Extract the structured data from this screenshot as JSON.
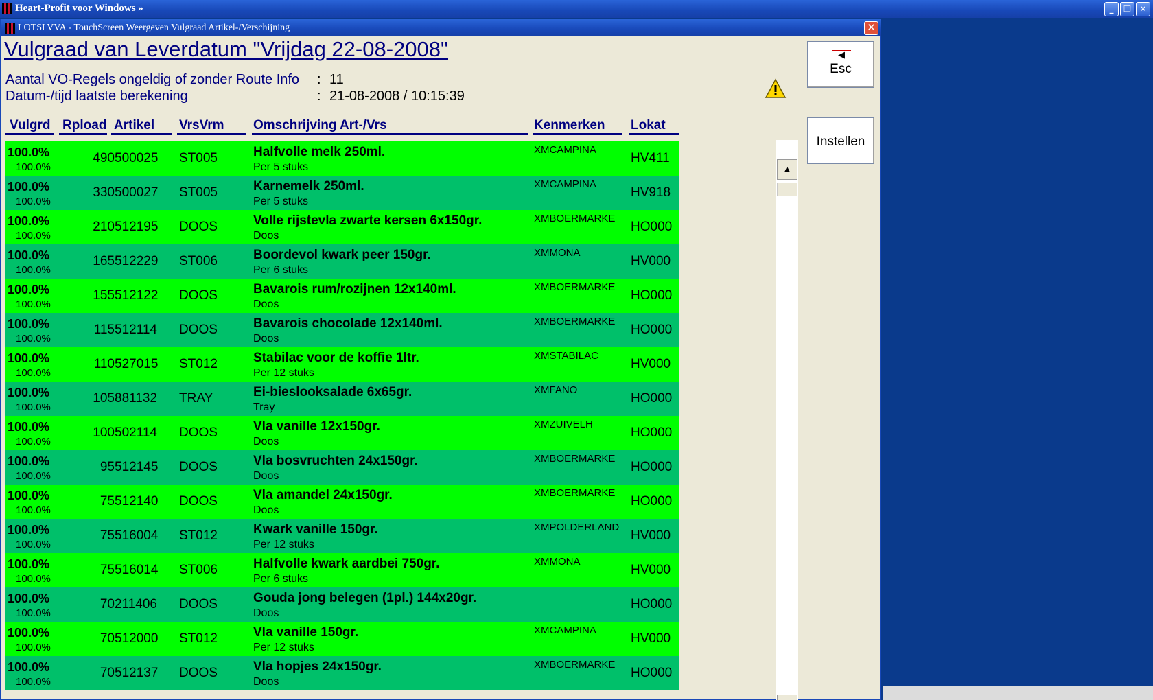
{
  "app": {
    "title": "Heart-Profit voor Windows  »"
  },
  "window": {
    "title": "LOTSLVVA - TouchScreen Weergeven Vulgraad Artikel-/Verschijning",
    "close_label": "✕"
  },
  "page_title": "Vulgraad van Leverdatum \"Vrijdag 22-08-2008\"",
  "info": {
    "invalid_label": "Aantal VO-Regels ongeldig of zonder Route Info",
    "invalid_value": "11",
    "calc_label": "Datum-/tijd laatste berekening",
    "calc_value": "21-08-2008 / 10:15:39",
    "colon": ":"
  },
  "buttons": {
    "esc": "Esc",
    "instellen": "Instellen"
  },
  "columns": [
    "Vulgrd",
    "Rpload",
    "Artikel",
    "VrsVrm",
    "Omschrijving Art-/Vrs",
    "Kenmerken",
    "Lokat"
  ],
  "rows": [
    {
      "vul": "100.0%",
      "vul2": "100.0%",
      "rp": "490",
      "art": "500025",
      "vrs": "ST005",
      "oms": "Halfvolle melk 250ml.",
      "sub": "Per 5 stuks",
      "ken": "XMCAMPINA",
      "lok": "HV411"
    },
    {
      "vul": "100.0%",
      "vul2": "100.0%",
      "rp": "330",
      "art": "500027",
      "vrs": "ST005",
      "oms": "Karnemelk 250ml.",
      "sub": "Per 5 stuks",
      "ken": "XMCAMPINA",
      "lok": "HV918"
    },
    {
      "vul": "100.0%",
      "vul2": "100.0%",
      "rp": "210",
      "art": "512195",
      "vrs": "DOOS",
      "oms": "Volle rijstevla zwarte kersen 6x150gr.",
      "sub": "Doos",
      "ken": "XMBOERMARKE",
      "lok": "HO000"
    },
    {
      "vul": "100.0%",
      "vul2": "100.0%",
      "rp": "165",
      "art": "512229",
      "vrs": "ST006",
      "oms": "Boordevol kwark peer 150gr.",
      "sub": "Per 6 stuks",
      "ken": "XMMONA",
      "lok": "HV000"
    },
    {
      "vul": "100.0%",
      "vul2": "100.0%",
      "rp": "155",
      "art": "512122",
      "vrs": "DOOS",
      "oms": "Bavarois rum/rozijnen 12x140ml.",
      "sub": "Doos",
      "ken": "XMBOERMARKE",
      "lok": "HO000"
    },
    {
      "vul": "100.0%",
      "vul2": "100.0%",
      "rp": "115",
      "art": "512114",
      "vrs": "DOOS",
      "oms": "Bavarois chocolade 12x140ml.",
      "sub": "Doos",
      "ken": "XMBOERMARKE",
      "lok": "HO000"
    },
    {
      "vul": "100.0%",
      "vul2": "100.0%",
      "rp": "110",
      "art": "527015",
      "vrs": "ST012",
      "oms": "Stabilac voor de koffie 1ltr.",
      "sub": "Per 12 stuks",
      "ken": "XMSTABILAC",
      "lok": "HV000"
    },
    {
      "vul": "100.0%",
      "vul2": "100.0%",
      "rp": "105",
      "art": "881132",
      "vrs": "TRAY",
      "oms": "Ei-bieslooksalade 6x65gr.",
      "sub": "Tray",
      "ken": "XMFANO",
      "lok": "HO000"
    },
    {
      "vul": "100.0%",
      "vul2": "100.0%",
      "rp": "100",
      "art": "502114",
      "vrs": "DOOS",
      "oms": "Vla vanille 12x150gr.",
      "sub": "Doos",
      "ken": "XMZUIVELH",
      "lok": "HO000"
    },
    {
      "vul": "100.0%",
      "vul2": "100.0%",
      "rp": "95",
      "art": "512145",
      "vrs": "DOOS",
      "oms": "Vla bosvruchten 24x150gr.",
      "sub": "Doos",
      "ken": "XMBOERMARKE",
      "lok": "HO000"
    },
    {
      "vul": "100.0%",
      "vul2": "100.0%",
      "rp": "75",
      "art": "512140",
      "vrs": "DOOS",
      "oms": "Vla amandel 24x150gr.",
      "sub": "Doos",
      "ken": "XMBOERMARKE",
      "lok": "HO000"
    },
    {
      "vul": "100.0%",
      "vul2": "100.0%",
      "rp": "75",
      "art": "516004",
      "vrs": "ST012",
      "oms": "Kwark vanille 150gr.",
      "sub": "Per 12 stuks",
      "ken": "XMPOLDERLAND",
      "lok": "HV000"
    },
    {
      "vul": "100.0%",
      "vul2": "100.0%",
      "rp": "75",
      "art": "516014",
      "vrs": "ST006",
      "oms": "Halfvolle kwark aardbei 750gr.",
      "sub": "Per 6 stuks",
      "ken": "XMMONA",
      "lok": "HV000"
    },
    {
      "vul": "100.0%",
      "vul2": "100.0%",
      "rp": "70",
      "art": "211406",
      "vrs": "DOOS",
      "oms": "Gouda jong belegen (1pl.) 144x20gr.",
      "sub": "Doos",
      "ken": "",
      "lok": "HO000"
    },
    {
      "vul": "100.0%",
      "vul2": "100.0%",
      "rp": "70",
      "art": "512000",
      "vrs": "ST012",
      "oms": "Vla vanille 150gr.",
      "sub": "Per 12 stuks",
      "ken": "XMCAMPINA",
      "lok": "HV000"
    },
    {
      "vul": "100.0%",
      "vul2": "100.0%",
      "rp": "70",
      "art": "512137",
      "vrs": "DOOS",
      "oms": "Vla hopjes 24x150gr.",
      "sub": "Doos",
      "ken": "XMBOERMARKE",
      "lok": "HO000"
    }
  ],
  "colors": {
    "row_bright": "#00ff00",
    "row_dark": "#00c06a",
    "header_text": "#000080"
  }
}
